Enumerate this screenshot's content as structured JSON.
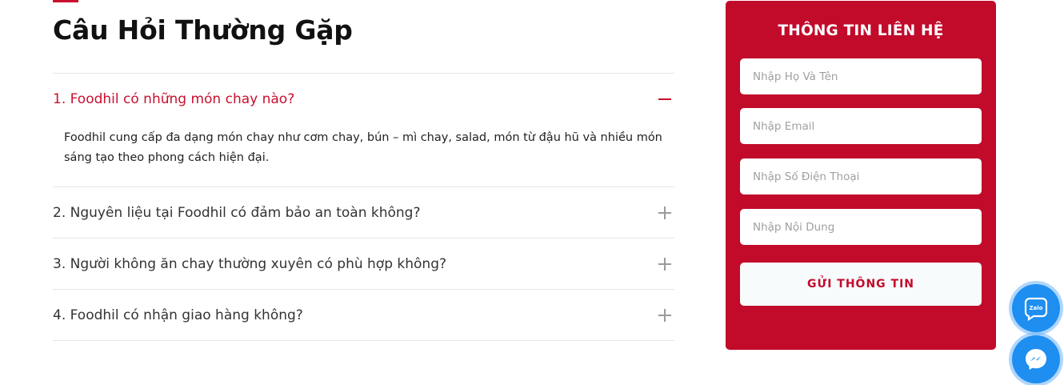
{
  "faq": {
    "title": "Câu Hỏi Thường Gặp",
    "items": [
      {
        "question": "1. Foodhil có những món chay nào?",
        "answer": "Foodhil cung cấp đa dạng món chay như cơm chay, bún – mì chay, salad, món từ đậu hũ và nhiều món sáng tạo theo phong cách hiện đại.",
        "expanded": true
      },
      {
        "question": "2. Nguyên liệu tại Foodhil có đảm bảo an toàn không?",
        "expanded": false
      },
      {
        "question": "3. Người không ăn chay thường xuyên có phù hợp không?",
        "expanded": false
      },
      {
        "question": "4. Foodhil có nhận giao hàng không?",
        "expanded": false
      }
    ]
  },
  "contact": {
    "title": "THÔNG TIN LIÊN HỆ",
    "name_placeholder": "Nhập Họ Và Tên",
    "email_placeholder": "Nhập Email",
    "phone_placeholder": "Nhập Số Điện Thoại",
    "message_placeholder": "Nhập Nội Dung",
    "submit_label": "GỬI THÔNG TIN"
  },
  "floating": {
    "zalo_label": "Zalo",
    "zalo_icon": "zalo-icon",
    "messenger_icon": "messenger-icon"
  },
  "colors": {
    "brand_red": "#c20a2b",
    "float_blue": "#1e8ef0"
  }
}
